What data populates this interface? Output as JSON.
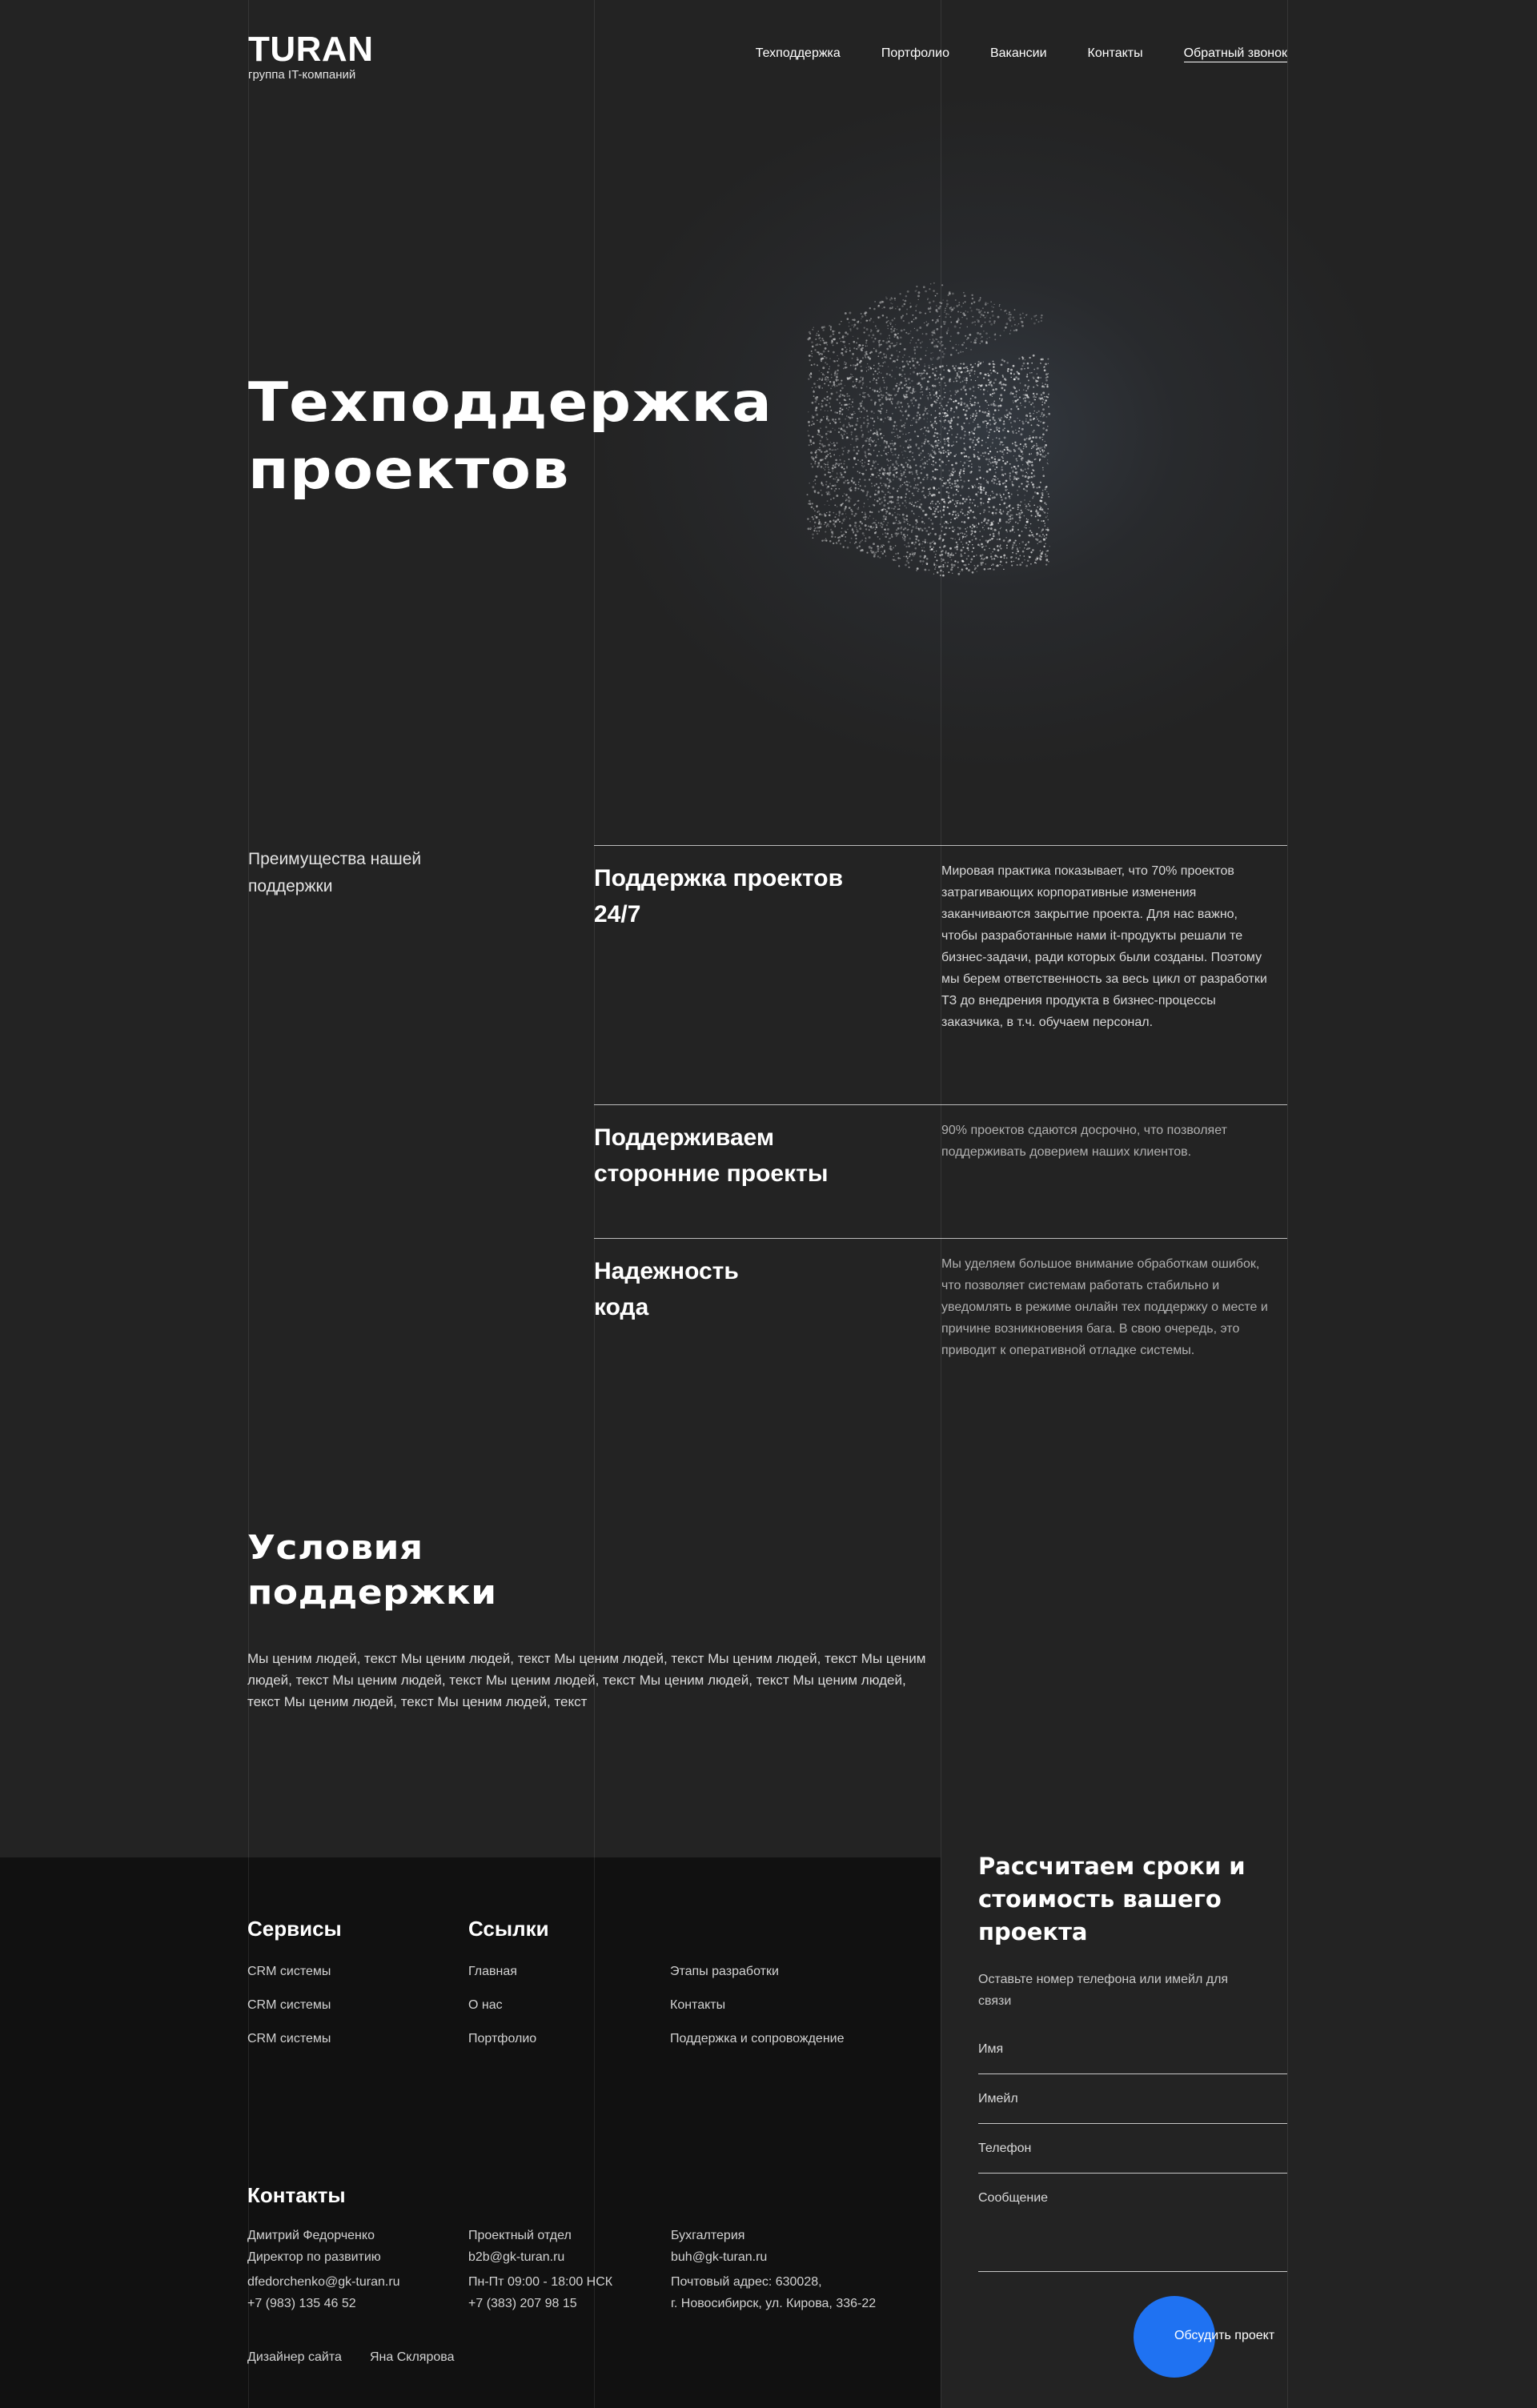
{
  "header": {
    "logo_name": "TURAN",
    "logo_sub": "группа IT-компаний",
    "nav": [
      "Техподдержка",
      "Портфолио",
      "Вакансии",
      "Контакты"
    ],
    "callback_label": "Обратный звонок"
  },
  "hero": {
    "title_line1": "Техподдержка",
    "title_line2": "проектов"
  },
  "advantages": {
    "heading": "Преимущества нашей поддержки",
    "items": [
      {
        "title": "Поддержка проектов 24/7",
        "text": "Мировая практика показывает,  что 70% проектов затрагивающих корпоративные изменения заканчиваются закрытие проекта. Для нас важно, чтобы разработанные нами it-продукты решали те бизнес-задачи, ради которых были созданы. Поэтому мы берем ответственность за весь цикл от разработки ТЗ до внедрения продукта в бизнес-процессы заказчика, в т.ч. обучаем персонал."
      },
      {
        "title": "Поддерживаем сторонние проекты",
        "text": "90% проектов сдаются досрочно, что позволяет поддерживать доверием наших клиентов."
      },
      {
        "title": "Надежность кода",
        "text": "Мы уделяем большое внимание обработкам ошибок, что позволяет системам работать стабильно и уведомлять в режиме онлайн тех поддержку о месте и причине возникновения бага. В свою очередь, это приводит к оперативной отладке системы."
      }
    ]
  },
  "conditions": {
    "title_line1": "Условия",
    "title_line2": "поддержки",
    "text": "Мы ценим людей, текст Мы ценим людей, текст Мы ценим людей, текст Мы ценим людей, текст Мы ценим людей, текст Мы ценим людей, текст Мы ценим людей, текст Мы ценим людей, текст Мы ценим людей, текст Мы ценим людей, текст Мы ценим людей, текст"
  },
  "footer": {
    "services_heading": "Сервисы",
    "services": [
      "CRM системы",
      "CRM системы",
      "CRM системы"
    ],
    "links_heading": "Ссылки",
    "links_col1": [
      "Главная",
      "О нас",
      "Портфолио"
    ],
    "links_col2": [
      "Этапы разработки",
      "Контакты",
      "Поддержка и сопровождение"
    ],
    "contacts_heading": "Контакты",
    "contact_person": {
      "name": "Дмитрий Федорченко",
      "role": "Директор по развитию",
      "email": "dfedorchenko@gk-turan.ru",
      "phone": "+7 (983) 135 46 52"
    },
    "project_dept": {
      "name": "Проектный отдел",
      "email": "b2b@gk-turan.ru",
      "hours": "Пн-Пт 09:00 - 18:00 НСК",
      "phone": "+7 (383) 207 98 15"
    },
    "accounting": {
      "name": "Бухгалтерия",
      "email": "buh@gk-turan.ru",
      "address_line1": "Почтовый адрес: 630028,",
      "address_line2": "г. Новосибирск, ул. Кирова, 336-22"
    },
    "designer_label": "Дизайнер сайта",
    "designer_name": "Яна Склярова"
  },
  "form": {
    "title": "Рассчитаем сроки и стоимость вашего проекта",
    "subtitle": "Оставьте номер телефона или имейл для связи",
    "name_placeholder": "Имя",
    "email_placeholder": "Имейл",
    "phone_placeholder": "Телефон",
    "message_placeholder": "Сообщение",
    "submit_label": "Обсудить проект",
    "accent_color": "#1f72f2"
  }
}
